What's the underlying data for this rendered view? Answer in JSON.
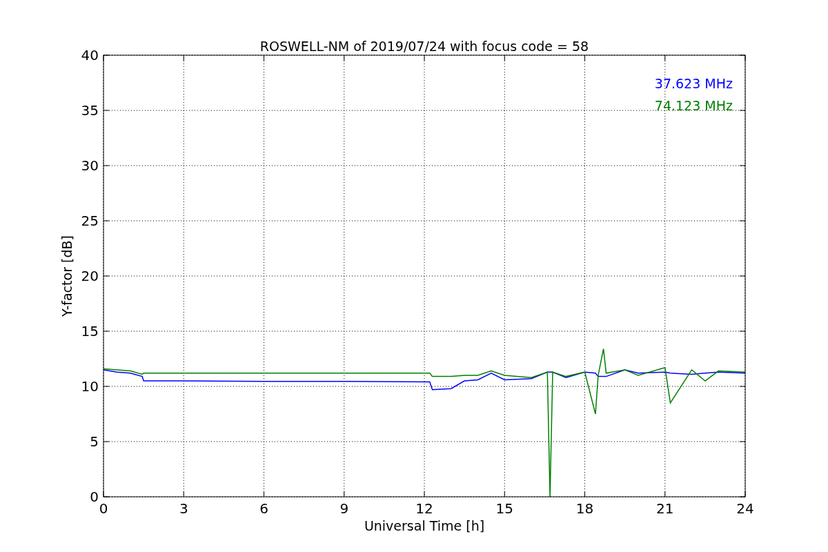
{
  "chart_data": {
    "type": "line",
    "title": "ROSWELL-NM of 2019/07/24 with focus code = 58",
    "xlabel": "Universal Time [h]",
    "ylabel": "Y-factor [dB]",
    "x": [
      0,
      0.5,
      1,
      1.45,
      1.5,
      3,
      6,
      9,
      12.2,
      12.3,
      13,
      13.5,
      14,
      14.5,
      15,
      16,
      16.6,
      16.7,
      16.8,
      17.3,
      18,
      18.4,
      18.5,
      18.7,
      18.8,
      19.5,
      20,
      21,
      21.2,
      22,
      22.5,
      23,
      24
    ],
    "series": [
      {
        "name": "37.623 MHz",
        "color": "#0000ff",
        "values": [
          11.5,
          11.3,
          11.2,
          10.9,
          10.5,
          10.5,
          10.45,
          10.45,
          10.4,
          9.7,
          9.8,
          10.5,
          10.6,
          11.2,
          10.6,
          10.7,
          11.3,
          11.3,
          11.3,
          10.8,
          11.3,
          11.2,
          10.9,
          10.9,
          10.9,
          11.5,
          11.2,
          11.3,
          11.2,
          11.1,
          11.2,
          11.3,
          11.2
        ]
      },
      {
        "name": "74.123 MHz",
        "color": "#008000",
        "values": [
          11.6,
          11.5,
          11.4,
          11.1,
          11.2,
          11.2,
          11.2,
          11.2,
          11.2,
          10.9,
          10.9,
          11.0,
          11.0,
          11.4,
          11.0,
          10.8,
          11.3,
          0,
          11.3,
          10.9,
          11.3,
          7.5,
          11.0,
          13.4,
          11.2,
          11.5,
          11.0,
          11.7,
          8.5,
          11.5,
          10.5,
          11.4,
          11.3
        ]
      }
    ],
    "grid": true,
    "xlim": [
      0,
      24
    ],
    "ylim": [
      0,
      40
    ],
    "xticks": [
      0,
      3,
      6,
      9,
      12,
      15,
      18,
      21,
      24
    ],
    "yticks": [
      0,
      5,
      10,
      15,
      20,
      25,
      30,
      35,
      40
    ]
  }
}
